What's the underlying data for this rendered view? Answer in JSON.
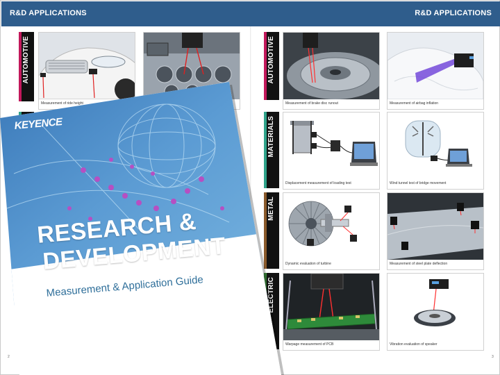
{
  "header": {
    "left_title": "R&D APPLICATIONS",
    "right_title": "R&D APPLICATIONS"
  },
  "page_numbers": {
    "left": "2",
    "right": "3"
  },
  "left_page": {
    "tabs": [
      {
        "label": "AUTOMOTIVE",
        "color": "#c2185b"
      }
    ],
    "cells": [
      {
        "caption": "Measurement of ride height"
      },
      {
        "caption": ""
      }
    ]
  },
  "right_page": {
    "tabs": [
      {
        "label": "AUTOMOTIVE",
        "color": "#c2185b"
      },
      {
        "label": "MATERIALS",
        "color": "#2fa38a"
      },
      {
        "label": "METAL",
        "color": "#8a5a2b"
      },
      {
        "label": "ELECTRIC",
        "color": "#3d8a3d"
      }
    ],
    "cells": [
      {
        "caption": "Measurement of brake disc runout"
      },
      {
        "caption": "Measurement of airbag inflation"
      },
      {
        "caption": "Displacement measurement of loading test"
      },
      {
        "caption": "Wind tunnel test of bridge movement"
      },
      {
        "caption": "Dynamic evaluation of turbine"
      },
      {
        "caption": "Measurement of steel plate deflection"
      },
      {
        "caption": "Warpage measurement of PCB"
      },
      {
        "caption": "Vibration evaluation of speaker"
      }
    ]
  },
  "cover": {
    "brand": "KEYENCE",
    "title_line1": "RESEARCH &",
    "title_line2": "DEVELOPMENT",
    "subtitle": "Measurement & Application Guide"
  },
  "colors": {
    "header": "#2f5d8c",
    "cover_blue": "#2f6f9a"
  }
}
